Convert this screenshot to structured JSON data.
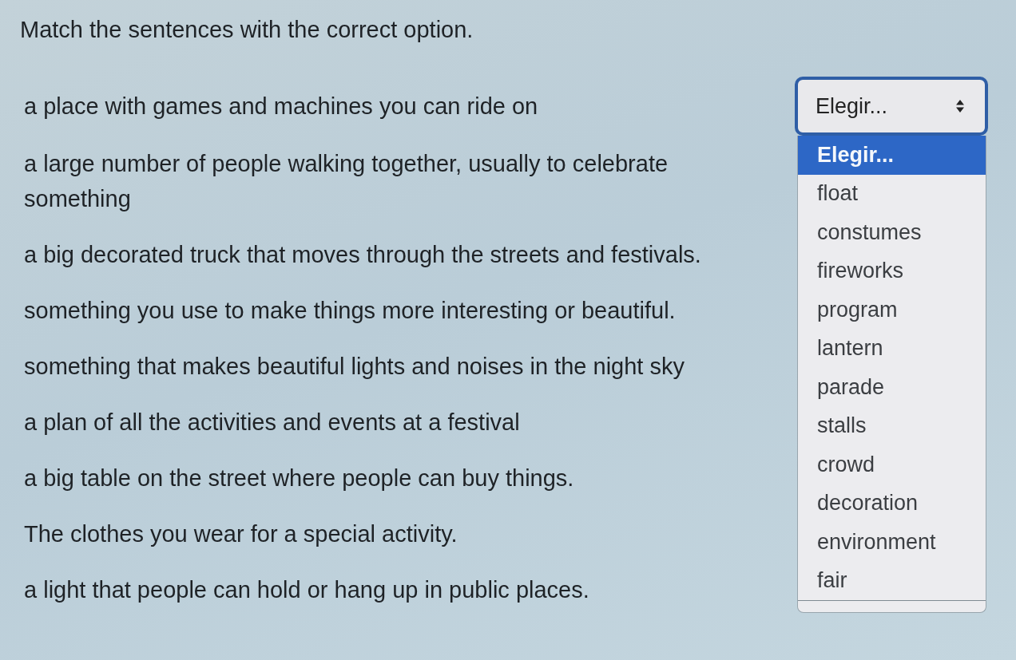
{
  "instruction": "Match the sentences with the correct option.",
  "items": [
    {
      "sentence": "a place with games and machines you can ride on",
      "answer": {
        "value": "Elegir...",
        "expanded": true,
        "options": [
          {
            "label": "Elegir...",
            "selected": true
          },
          {
            "label": "float",
            "selected": false
          },
          {
            "label": "constumes",
            "selected": false
          },
          {
            "label": "fireworks",
            "selected": false
          },
          {
            "label": "program",
            "selected": false
          },
          {
            "label": "lantern",
            "selected": false
          },
          {
            "label": "parade",
            "selected": false
          },
          {
            "label": "stalls",
            "selected": false
          },
          {
            "label": "crowd",
            "selected": false
          },
          {
            "label": "decoration",
            "selected": false
          },
          {
            "label": "environment",
            "selected": false
          },
          {
            "label": "fair",
            "selected": false
          }
        ]
      }
    },
    {
      "sentence": "a large number of people walking together, usually to celebrate something"
    },
    {
      "sentence": "a big decorated truck that moves through the streets and festivals."
    },
    {
      "sentence": "something you use to make things more interesting or beautiful."
    },
    {
      "sentence": "something that makes beautiful lights and noises in the night sky"
    },
    {
      "sentence": "a plan of all the activities and events at a festival"
    },
    {
      "sentence": "a big table on the street where people can buy things."
    },
    {
      "sentence": "The clothes you wear for a special activity."
    },
    {
      "sentence": "a light that people can hold or hang up in public places."
    }
  ]
}
